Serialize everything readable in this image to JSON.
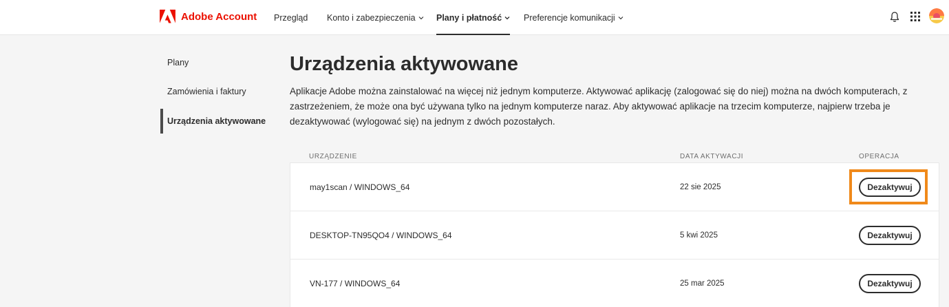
{
  "header": {
    "brand": "Adobe Account",
    "brand_color": "#eb1000",
    "nav": [
      {
        "label": "Przegląd",
        "has_dropdown": false,
        "active": false
      },
      {
        "label": "Konto i zabezpieczenia",
        "has_dropdown": true,
        "active": false
      },
      {
        "label": "Plany i płatność",
        "has_dropdown": true,
        "active": true
      },
      {
        "label": "Preferencje komunikacji",
        "has_dropdown": true,
        "active": false
      }
    ],
    "icons": [
      "bell-icon",
      "apps-grid-icon",
      "avatar"
    ]
  },
  "sidebar": {
    "items": [
      {
        "label": "Plany",
        "active": false
      },
      {
        "label": "Zamówienia i faktury",
        "active": false
      },
      {
        "label": "Urządzenia aktywowane",
        "active": true
      }
    ]
  },
  "main": {
    "title": "Urządzenia aktywowane",
    "description": "Aplikacje Adobe można zainstalować na więcej niż jednym komputerze. Aktywować aplikację (zalogować się do niej) można na dwóch komputerach, z zastrzeżeniem, że może ona być używana tylko na jednym komputerze naraz. Aby aktywować aplikacje na trzecim komputerze, najpierw trzeba je dezaktywować (wylogować się) na jednym z dwóch pozostałych.",
    "columns": {
      "device": "URZĄDZENIE",
      "date": "DATA AKTYWACJI",
      "action": "OPERACJA"
    },
    "rows": [
      {
        "device": "may1scan / WINDOWS_64",
        "date": "22 sie 2025",
        "action": "Dezaktywuj"
      },
      {
        "device": "DESKTOP-TN95QO4 / WINDOWS_64",
        "date": "5 kwi 2025",
        "action": "Dezaktywuj"
      },
      {
        "device": "VN-177 / WINDOWS_64",
        "date": "25 mar 2025",
        "action": "Dezaktywuj"
      }
    ],
    "highlight_color": "#f0891a"
  }
}
